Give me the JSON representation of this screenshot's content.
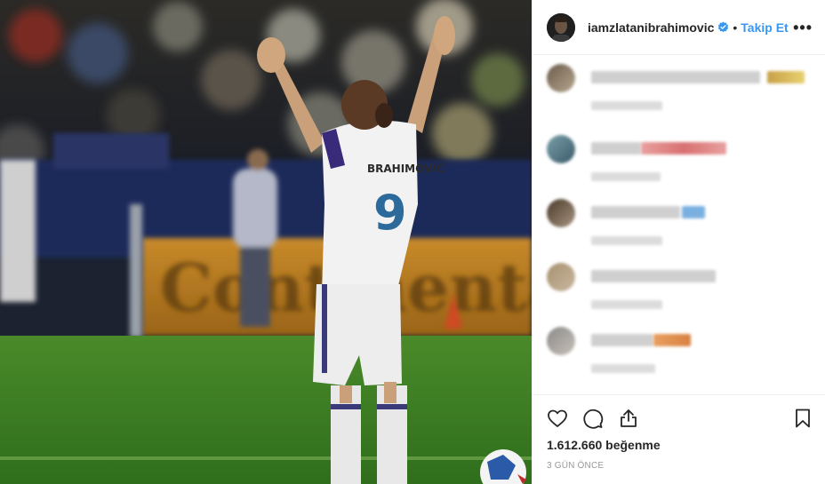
{
  "post": {
    "username": "iamzlatanibrahimovic",
    "separator": "•",
    "follow_label": "Takip Et",
    "more_label": "•••",
    "likes_text": "1.612.660 beğenme",
    "time_text": "3 GÜN ÖNCE",
    "photo": {
      "jersey_name": "BRAHIMOVIĆ",
      "jersey_number": "9",
      "banner_text": "Continental"
    }
  },
  "icons": {
    "verified": "verified-badge-icon",
    "like": "heart-icon",
    "comment": "comment-bubble-icon",
    "share": "share-icon",
    "save": "bookmark-icon",
    "more": "more-options-icon"
  },
  "colors": {
    "accent": "#3897f0",
    "text": "#262626",
    "muted": "#999999",
    "border": "#efefef"
  }
}
